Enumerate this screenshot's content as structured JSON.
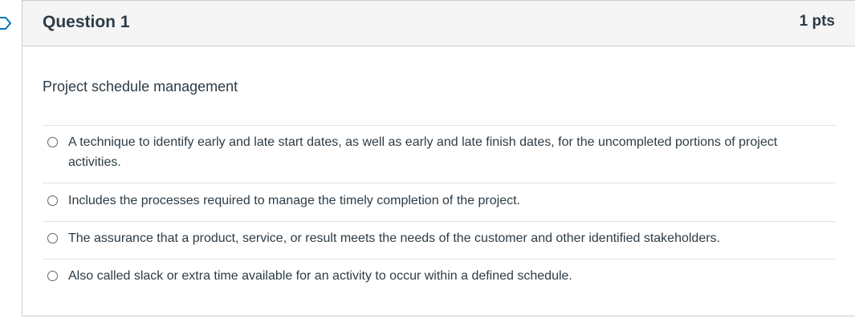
{
  "question": {
    "title": "Question 1",
    "points": "1 pts",
    "text": "Project schedule management",
    "answers": [
      {
        "label": "A technique to identify early and late start dates, as well as early and late finish dates, for the uncompleted portions of project activities."
      },
      {
        "label": "Includes the processes required to manage the timely completion of the project."
      },
      {
        "label": "The assurance that a product, service, or result meets the needs of the customer and other identified stakeholders."
      },
      {
        "label": "Also called slack or extra time available for an activity to occur within a defined schedule."
      }
    ]
  },
  "colors": {
    "text": "#2d3b45",
    "header_bg": "#f5f5f5",
    "border": "#c7cdd1",
    "flag": "#0374b5"
  },
  "icons": {
    "flag": "bookmark-flag-icon"
  }
}
